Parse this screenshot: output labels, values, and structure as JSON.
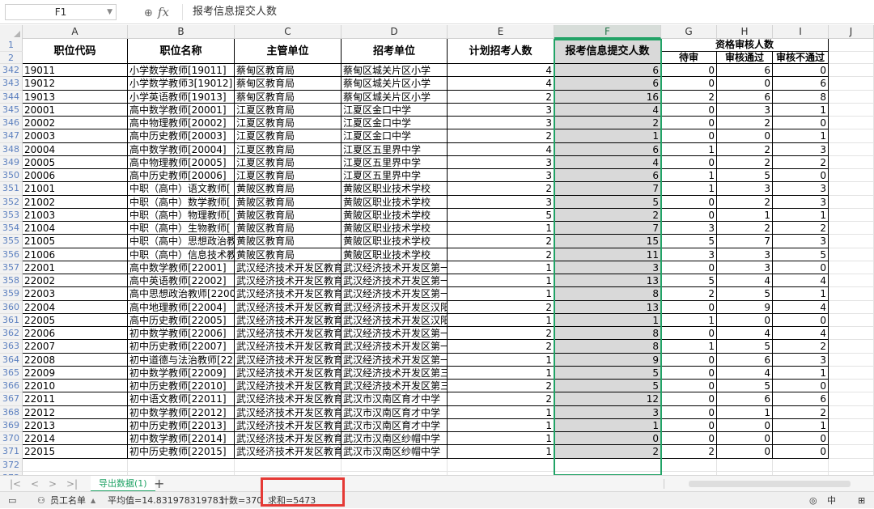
{
  "formula_bar": {
    "cell_ref": "F1",
    "content": "报考信息提交人数"
  },
  "columns": [
    "A",
    "B",
    "C",
    "D",
    "E",
    "F",
    "G",
    "H",
    "I",
    "J"
  ],
  "headers": {
    "a": "职位代码",
    "b": "职位名称",
    "c": "主管单位",
    "d": "招考单位",
    "e": "计划招考人数",
    "f": "报考信息提交人数",
    "ghi_group": "资格审核人数",
    "g": "待审",
    "h": "审核通过",
    "i": "审核不通过"
  },
  "header_row_numbers": [
    "1",
    "2"
  ],
  "rows": [
    {
      "n": "342",
      "a": "19011",
      "b": "小学数学教师[19011]",
      "c": "蔡甸区教育局",
      "d": "蔡甸区城关片区小学",
      "e": "4",
      "f": "6",
      "g": "0",
      "h": "6",
      "i": "0"
    },
    {
      "n": "343",
      "a": "19012",
      "b": "小学数学教师3[19012]",
      "c": "蔡甸区教育局",
      "d": "蔡甸区城关片区小学",
      "e": "4",
      "f": "6",
      "g": "0",
      "h": "0",
      "i": "6"
    },
    {
      "n": "344",
      "a": "19013",
      "b": "小学英语教师[19013]",
      "c": "蔡甸区教育局",
      "d": "蔡甸区城关片区小学",
      "e": "2",
      "f": "16",
      "g": "2",
      "h": "6",
      "i": "8"
    },
    {
      "n": "345",
      "a": "20001",
      "b": "高中数学教师[20001]",
      "c": "江夏区教育局",
      "d": "江夏区金口中学",
      "e": "3",
      "f": "4",
      "g": "0",
      "h": "3",
      "i": "1"
    },
    {
      "n": "346",
      "a": "20002",
      "b": "高中物理教师[20002]",
      "c": "江夏区教育局",
      "d": "江夏区金口中学",
      "e": "3",
      "f": "2",
      "g": "0",
      "h": "2",
      "i": "0"
    },
    {
      "n": "347",
      "a": "20003",
      "b": "高中历史教师[20003]",
      "c": "江夏区教育局",
      "d": "江夏区金口中学",
      "e": "2",
      "f": "1",
      "g": "0",
      "h": "0",
      "i": "1"
    },
    {
      "n": "348",
      "a": "20004",
      "b": "高中数学教师[20004]",
      "c": "江夏区教育局",
      "d": "江夏区五里界中学",
      "e": "4",
      "f": "6",
      "g": "1",
      "h": "2",
      "i": "3"
    },
    {
      "n": "349",
      "a": "20005",
      "b": "高中物理教师[20005]",
      "c": "江夏区教育局",
      "d": "江夏区五里界中学",
      "e": "3",
      "f": "4",
      "g": "0",
      "h": "2",
      "i": "2"
    },
    {
      "n": "350",
      "a": "20006",
      "b": "高中历史教师[20006]",
      "c": "江夏区教育局",
      "d": "江夏区五里界中学",
      "e": "3",
      "f": "6",
      "g": "1",
      "h": "5",
      "i": "0"
    },
    {
      "n": "351",
      "a": "21001",
      "b": "中职（高中）语文教师[",
      "c": "黄陂区教育局",
      "d": "黄陂区职业技术学校",
      "e": "2",
      "f": "7",
      "g": "1",
      "h": "3",
      "i": "3"
    },
    {
      "n": "352",
      "a": "21002",
      "b": "中职（高中）数学教师[",
      "c": "黄陂区教育局",
      "d": "黄陂区职业技术学校",
      "e": "3",
      "f": "5",
      "g": "0",
      "h": "2",
      "i": "3"
    },
    {
      "n": "353",
      "a": "21003",
      "b": "中职（高中）物理教师[",
      "c": "黄陂区教育局",
      "d": "黄陂区职业技术学校",
      "e": "5",
      "f": "2",
      "g": "0",
      "h": "1",
      "i": "1"
    },
    {
      "n": "354",
      "a": "21004",
      "b": "中职（高中）生物教师[",
      "c": "黄陂区教育局",
      "d": "黄陂区职业技术学校",
      "e": "1",
      "f": "7",
      "g": "3",
      "h": "2",
      "i": "2"
    },
    {
      "n": "355",
      "a": "21005",
      "b": "中职（高中）思想政治教",
      "c": "黄陂区教育局",
      "d": "黄陂区职业技术学校",
      "e": "2",
      "f": "15",
      "g": "5",
      "h": "7",
      "i": "3"
    },
    {
      "n": "356",
      "a": "21006",
      "b": "中职（高中）信息技术教",
      "c": "黄陂区教育局",
      "d": "黄陂区职业技术学校",
      "e": "2",
      "f": "11",
      "g": "3",
      "h": "3",
      "i": "5"
    },
    {
      "n": "357",
      "a": "22001",
      "b": "高中数学教师[22001]",
      "c": "武汉经济技术开发区教育",
      "d": "武汉经济技术开发区第一",
      "e": "1",
      "f": "3",
      "g": "0",
      "h": "3",
      "i": "0"
    },
    {
      "n": "358",
      "a": "22002",
      "b": "高中英语教师[22002]",
      "c": "武汉经济技术开发区教育",
      "d": "武汉经济技术开发区第一",
      "e": "1",
      "f": "13",
      "g": "5",
      "h": "4",
      "i": "4"
    },
    {
      "n": "359",
      "a": "22003",
      "b": "高中思想政治教师[2200",
      "c": "武汉经济技术开发区教育",
      "d": "武汉经济技术开发区第一",
      "e": "1",
      "f": "8",
      "g": "2",
      "h": "5",
      "i": "1"
    },
    {
      "n": "360",
      "a": "22004",
      "b": "高中地理教师[22004]",
      "c": "武汉经济技术开发区教育",
      "d": "武汉经济技术开发区汉阳",
      "e": "2",
      "f": "13",
      "g": "0",
      "h": "9",
      "i": "4"
    },
    {
      "n": "361",
      "a": "22005",
      "b": "高中历史教师[22005]",
      "c": "武汉经济技术开发区教育",
      "d": "武汉经济技术开发区汉阳",
      "e": "1",
      "f": "1",
      "g": "1",
      "h": "0",
      "i": "0"
    },
    {
      "n": "362",
      "a": "22006",
      "b": "初中数学教师[22006]",
      "c": "武汉经济技术开发区教育",
      "d": "武汉经济技术开发区第一",
      "e": "2",
      "f": "8",
      "g": "0",
      "h": "4",
      "i": "4"
    },
    {
      "n": "363",
      "a": "22007",
      "b": "初中历史教师[22007]",
      "c": "武汉经济技术开发区教育",
      "d": "武汉经济技术开发区第一",
      "e": "2",
      "f": "8",
      "g": "1",
      "h": "5",
      "i": "2"
    },
    {
      "n": "364",
      "a": "22008",
      "b": "初中道德与法治教师[22",
      "c": "武汉经济技术开发区教育",
      "d": "武汉经济技术开发区第一",
      "e": "1",
      "f": "9",
      "g": "0",
      "h": "6",
      "i": "3"
    },
    {
      "n": "365",
      "a": "22009",
      "b": "初中数学教师[22009]",
      "c": "武汉经济技术开发区教育",
      "d": "武汉经济技术开发区第三",
      "e": "1",
      "f": "5",
      "g": "0",
      "h": "4",
      "i": "1"
    },
    {
      "n": "366",
      "a": "22010",
      "b": "初中历史教师[22010]",
      "c": "武汉经济技术开发区教育",
      "d": "武汉经济技术开发区第三",
      "e": "2",
      "f": "5",
      "g": "0",
      "h": "5",
      "i": "0"
    },
    {
      "n": "367",
      "a": "22011",
      "b": "初中语文教师[22011]",
      "c": "武汉经济技术开发区教育",
      "d": "武汉市汉南区育才中学",
      "e": "2",
      "f": "12",
      "g": "0",
      "h": "6",
      "i": "6"
    },
    {
      "n": "368",
      "a": "22012",
      "b": "初中数学教师[22012]",
      "c": "武汉经济技术开发区教育",
      "d": "武汉市汉南区育才中学",
      "e": "1",
      "f": "3",
      "g": "0",
      "h": "1",
      "i": "2"
    },
    {
      "n": "369",
      "a": "22013",
      "b": "初中历史教师[22013]",
      "c": "武汉经济技术开发区教育",
      "d": "武汉市汉南区育才中学",
      "e": "1",
      "f": "1",
      "g": "0",
      "h": "0",
      "i": "1"
    },
    {
      "n": "370",
      "a": "22014",
      "b": "初中数学教师[22014]",
      "c": "武汉经济技术开发区教育",
      "d": "武汉市汉南区纱帽中学",
      "e": "1",
      "f": "0",
      "g": "0",
      "h": "0",
      "i": "0"
    },
    {
      "n": "371",
      "a": "22015",
      "b": "初中历史教师[22015]",
      "c": "武汉经济技术开发区教育",
      "d": "武汉市汉南区纱帽中学",
      "e": "1",
      "f": "2",
      "g": "2",
      "h": "0",
      "i": "0"
    }
  ],
  "empty_rows": [
    "372",
    "373"
  ],
  "sheet_tabs": {
    "nav": [
      "|<",
      "<",
      ">",
      ">|"
    ],
    "active": "导出数据(1)",
    "add": "+"
  },
  "status_bar": {
    "sheet_list": "员工名单",
    "average": "平均值=14.831978319783",
    "count": "计数=370",
    "sum": "求和=5473",
    "view_label": "中"
  },
  "colors": {
    "selection": "#21a366",
    "highlight_box": "#e53935",
    "selected_column_fill": "#d9d9d9"
  }
}
